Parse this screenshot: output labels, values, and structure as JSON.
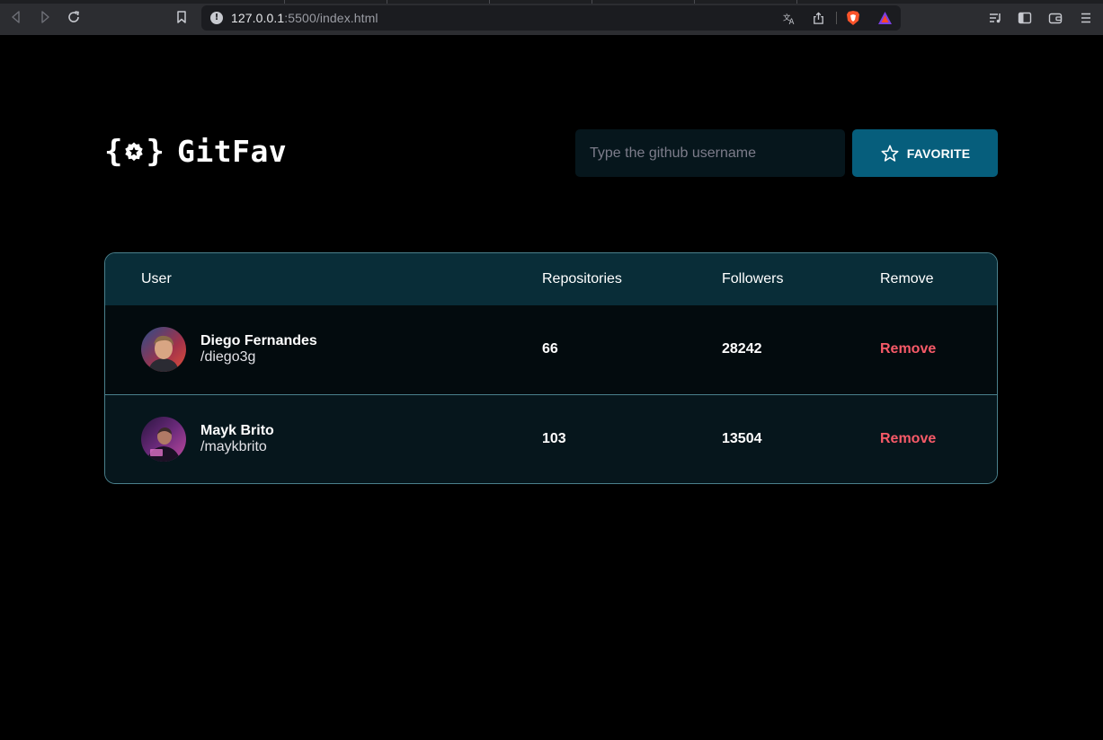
{
  "browser": {
    "url_host": "127.0.0.1",
    "url_path": ":5500/index.html"
  },
  "app": {
    "brace_open": "{",
    "brace_close": "}",
    "name": "GitFav"
  },
  "search": {
    "placeholder": "Type the github username"
  },
  "favorite_button": {
    "label": "FAVORITE"
  },
  "table": {
    "headers": [
      "User",
      "Repositories",
      "Followers",
      "Remove"
    ],
    "rows": [
      {
        "name": "Diego Fernandes",
        "login": "/diego3g",
        "repositories": "66",
        "followers": "28242",
        "remove_label": "Remove"
      },
      {
        "name": "Mayk Brito",
        "login": "/maykbrito",
        "repositories": "103",
        "followers": "13504",
        "remove_label": "Remove"
      }
    ]
  },
  "colors": {
    "background": "#000000",
    "table_header": "#092d38",
    "button": "#065e7c",
    "remove": "#f75a68"
  }
}
